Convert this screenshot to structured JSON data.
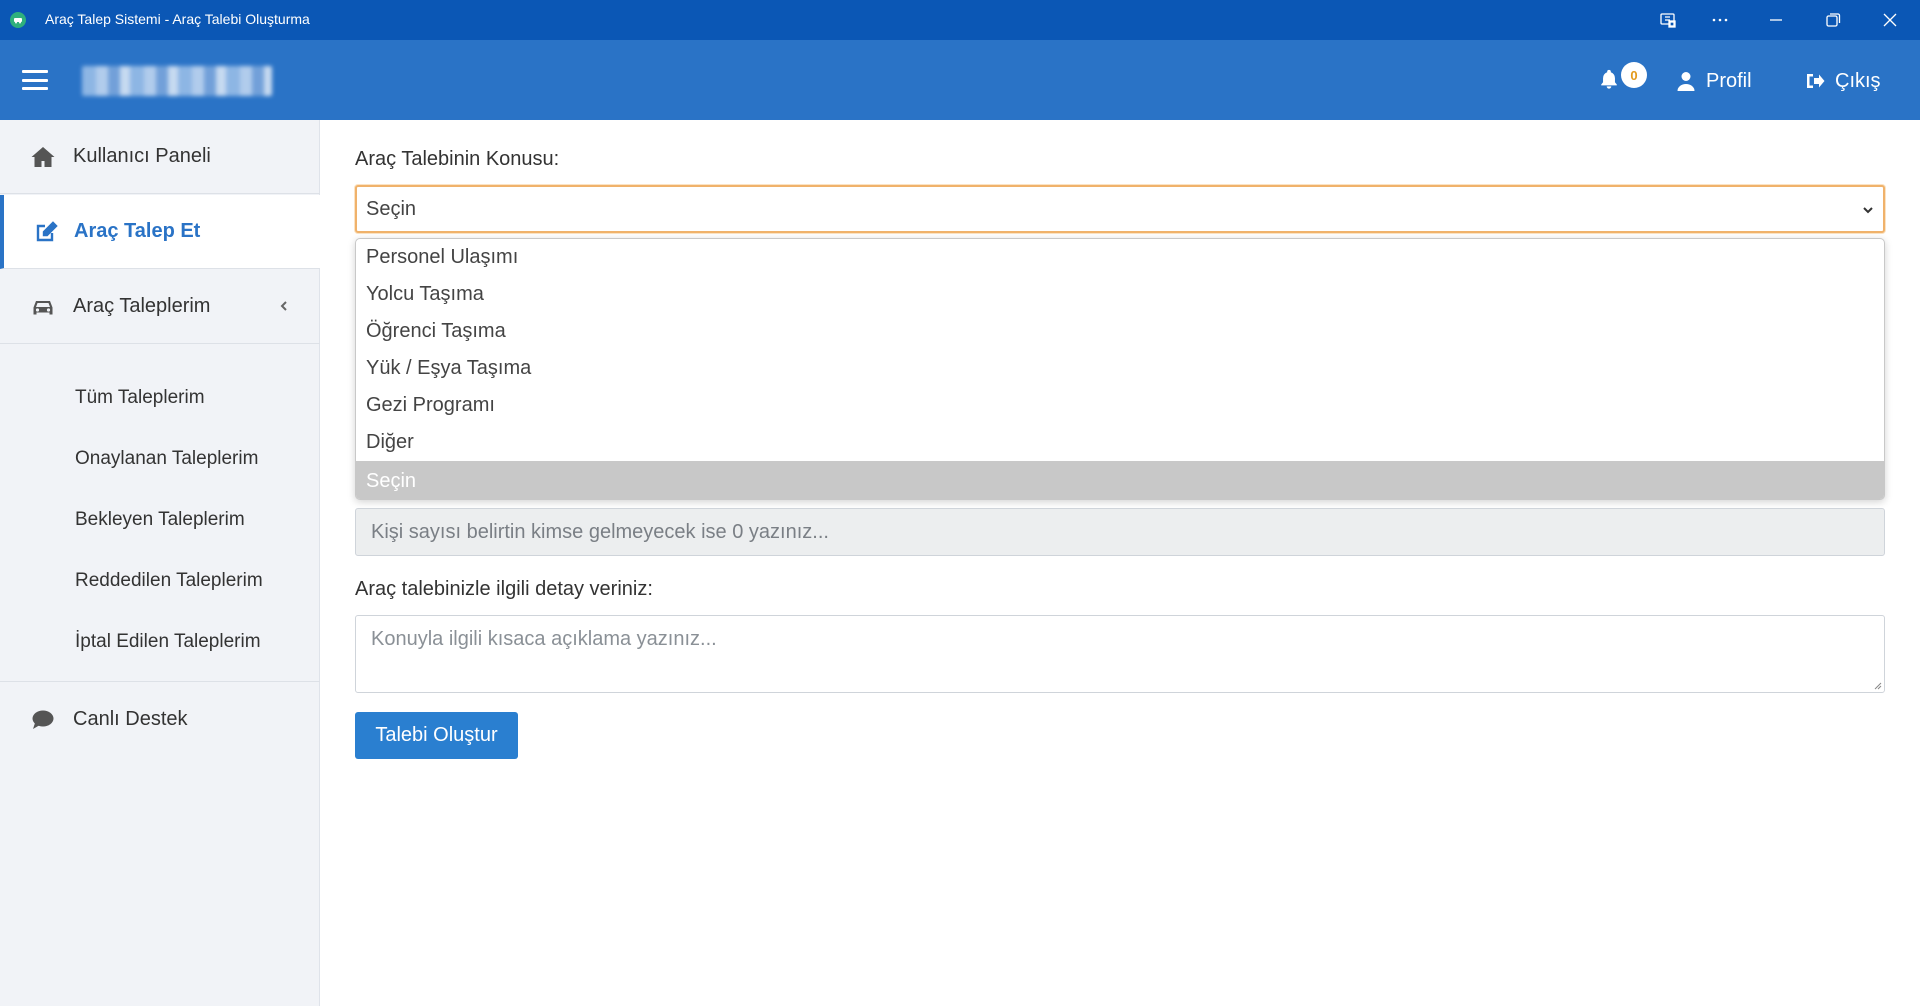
{
  "window": {
    "title": "Araç Talep Sistemi - Araç Talebi Oluşturma"
  },
  "header": {
    "notification_count": "0",
    "profile_label": "Profil",
    "logout_label": "Çıkış"
  },
  "sidebar": {
    "items": [
      {
        "label": "Kullanıcı Paneli",
        "icon": "home-icon"
      },
      {
        "label": "Araç Talep Et",
        "icon": "edit-icon",
        "active": true
      },
      {
        "label": "Araç Taleplerim",
        "icon": "car-icon"
      },
      {
        "label": "Canlı Destek",
        "icon": "chat-icon"
      }
    ],
    "sub_items": [
      "Tüm Taleplerim",
      "Onaylanan Taleplerim",
      "Bekleyen Taleplerim",
      "Reddedilen Taleplerim",
      "İptal Edilen Taleplerim"
    ]
  },
  "form": {
    "subject_label": "Araç Talebinin Konusu:",
    "subject_value": "Seçin",
    "subject_options": [
      "Personel Ulaşımı",
      "Yolcu Taşıma",
      "Öğrenci Taşıma",
      "Yük / Eşya Taşıma",
      "Gezi Programı",
      "Diğer",
      "Seçin"
    ],
    "person_count_placeholder": "Kişi sayısı belirtin kimse gelmeyecek ise 0 yazınız...",
    "detail_label": "Araç talebinizle ilgili detay veriniz:",
    "detail_placeholder": "Konuyla ilgili kısaca açıklama yazınız...",
    "submit_label": "Talebi Oluştur"
  },
  "colors": {
    "titlebar": "#0b57b5",
    "header": "#2a73c6",
    "accent": "#2a73c6",
    "focus_border": "#f0b26b",
    "badge_text": "#e39a1b"
  }
}
